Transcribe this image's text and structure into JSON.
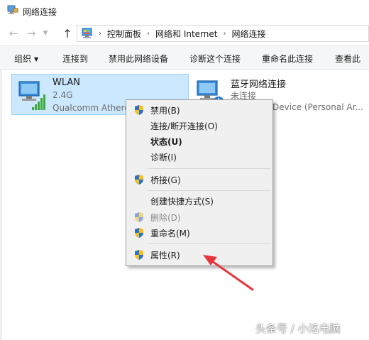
{
  "window": {
    "title": "网络连接"
  },
  "address_bar": {
    "crumbs": [
      "控制面板",
      "网络和 Internet",
      "网络连接"
    ]
  },
  "toolbar": {
    "organize": "组织",
    "connect_to": "连接到",
    "disable_device": "禁用此网络设备",
    "diagnose": "诊断这个连接",
    "rename": "重命名此连接",
    "view_status": "查看此"
  },
  "connections": [
    {
      "name": "WLAN",
      "status": "2.4G",
      "device": "Qualcomm Athero"
    },
    {
      "name": "蓝牙网络连接",
      "status": "未连接",
      "device": "Device (Personal Ar..."
    }
  ],
  "context_menu": {
    "items": [
      {
        "label": "禁用(B)",
        "shield": true,
        "bold": false,
        "disabled": false
      },
      {
        "label": "连接/断开连接(O)",
        "shield": false,
        "bold": false,
        "disabled": false
      },
      {
        "label": "状态(U)",
        "shield": false,
        "bold": true,
        "disabled": false
      },
      {
        "label": "诊断(I)",
        "shield": false,
        "bold": false,
        "disabled": false
      },
      {
        "label": "桥接(G)",
        "shield": true,
        "bold": false,
        "disabled": false
      },
      {
        "label": "创建快捷方式(S)",
        "shield": false,
        "bold": false,
        "disabled": false
      },
      {
        "label": "删除(D)",
        "shield": true,
        "bold": false,
        "disabled": true
      },
      {
        "label": "重命名(M)",
        "shield": true,
        "bold": false,
        "disabled": false
      },
      {
        "label": "属性(R)",
        "shield": true,
        "bold": false,
        "disabled": false
      }
    ]
  },
  "watermark": "头条号 / 小洺电脑",
  "colors": {
    "selection_bg": "#cce8ff",
    "selection_border": "#99d1ff",
    "annotation_red": "#e8353a",
    "menu_bg": "#f0f0f0"
  }
}
